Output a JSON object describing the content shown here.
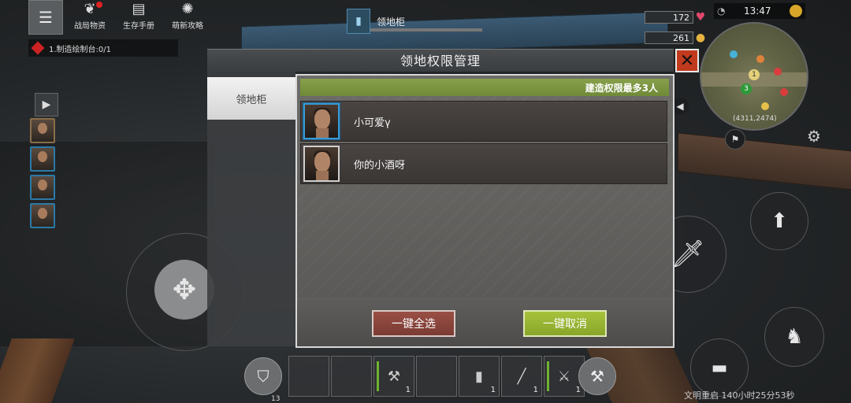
{
  "toolbar": {
    "items": [
      {
        "label": "战局物资",
        "icon": "gift-icon"
      },
      {
        "label": "生存手册",
        "icon": "book-icon"
      },
      {
        "label": "萌新攻略",
        "icon": "compass-icon"
      }
    ]
  },
  "quest": {
    "text": "1.制造绘制台:0/1"
  },
  "target": {
    "name": "领地柜"
  },
  "stats": {
    "health": "172",
    "food": "261"
  },
  "clock": {
    "time": "13:47"
  },
  "minimap": {
    "coords": "(4311,2474)",
    "marker_labels": [
      "1",
      "3"
    ]
  },
  "dialog": {
    "title": "领地权限管理",
    "side_tab": "领地柜",
    "limit_text": "建造权限最多3人",
    "members": [
      {
        "name": "小可爱γ",
        "selected": true
      },
      {
        "name": "你的小酒呀",
        "selected": false
      }
    ],
    "select_all_label": "一键全选",
    "cancel_all_label": "一键取消",
    "close_symbol": "✕"
  },
  "hotbar": {
    "counts": [
      "1",
      "1",
      "1",
      "1"
    ],
    "level": "13"
  },
  "rebuild_text": "文明重启 140小时25分53秒",
  "colors": {
    "accent_green": "#8aa62a",
    "danger_red": "#c23a1e",
    "select_blue": "#3a9ad6",
    "limit_bar": "#7f9843"
  }
}
